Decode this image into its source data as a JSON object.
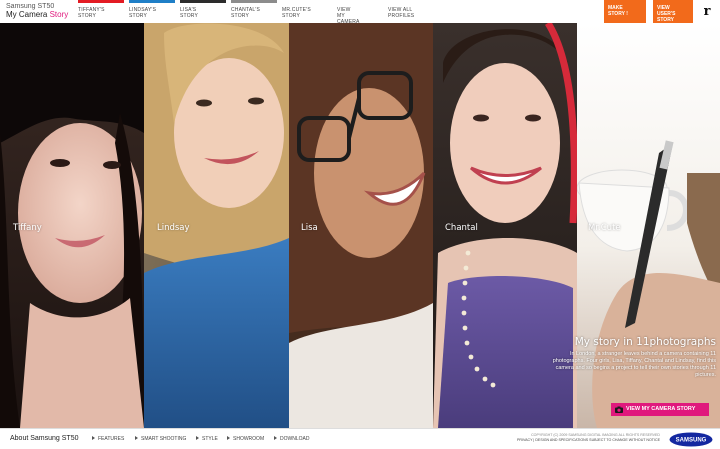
{
  "header": {
    "brand_line1": "Samsung ST50",
    "brand_line2_prefix": "My Camera ",
    "brand_line2_accent": "Story",
    "nav": [
      {
        "l1": "Tiffany's",
        "l2": "Story",
        "color": "#e31b23"
      },
      {
        "l1": "Lindsay's",
        "l2": "Story",
        "color": "#1f7fc7"
      },
      {
        "l1": "Lisa's",
        "l2": "Story",
        "color": "#2c2c2c"
      },
      {
        "l1": "Chantal's",
        "l2": "Story",
        "color": "#8c8c8c"
      },
      {
        "l1": "Mr.Cute's",
        "l2": "Story",
        "color": "#ffffff"
      },
      {
        "l1": "View My",
        "l2": "Camera Story",
        "color": "#ffffff"
      },
      {
        "l1": "View All",
        "l2": "Profiles",
        "color": "#ffffff"
      }
    ],
    "cta_make": {
      "l1": "Make",
      "l2": "Story !"
    },
    "cta_view": {
      "l1": "View",
      "l2": "User's",
      "l3": "Story"
    },
    "logo_mark": "r",
    "accent_orange": "#f26a1b"
  },
  "strips": [
    {
      "name": "Tiffany"
    },
    {
      "name": "Lindsay"
    },
    {
      "name": "Lisa"
    },
    {
      "name": "Chantal"
    },
    {
      "name": "Mr.Cute"
    }
  ],
  "story": {
    "title": "My story in 11photographs",
    "text": "In London, a stranger leaves behind a camera containing 11 photographs. Four girls, Lisa, Tiffany, Chantal and Lindsay, find this camera and so begins a project to tell their own stories through 11 pictures.",
    "button": "View My Camera Story",
    "accent_pink": "#e0197d"
  },
  "footer": {
    "about": "About Samsung ST50",
    "links": [
      "Features",
      "Smart Shooting",
      "Style",
      "Showroom",
      "Download"
    ],
    "copyright": "COPYRIGHT (C) 2009 SAMSUNG DIGITAL IMAGING ALL RIGHTS RESERVED",
    "legal_links": "PRIVACY | DESIGN AND SPECIFICATIONS SUBJECT TO CHANGE WITHOUT NOTICE",
    "samsung_logo": "SAMSUNG"
  }
}
